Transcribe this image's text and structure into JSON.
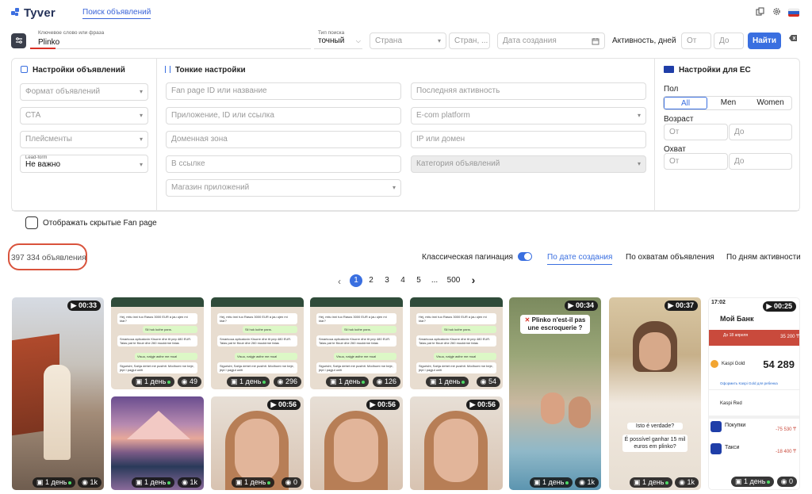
{
  "header": {
    "logo": "Tyver",
    "nav_link": "Поиск объявлений",
    "icons": [
      "copy-icon",
      "gear-icon",
      "flag-ru-icon"
    ]
  },
  "search": {
    "keyword_label": "Ключевое слово или фраза",
    "keyword_value": "Plinko",
    "search_type_label": "Тип поиска",
    "search_type_value": "точный",
    "country_placeholder": "Страна",
    "country2_placeholder": "Стран, ...",
    "created_placeholder": "Дата создания",
    "activity_label": "Активность, дней",
    "from_placeholder": "От",
    "to_placeholder": "До",
    "find_button": "Найти"
  },
  "ad_settings": {
    "title": "Настройки объявлений",
    "format_placeholder": "Формат объявлений",
    "cta_placeholder": "СТА",
    "placements_placeholder": "Плейсменты",
    "leadform_label": "Lead-form",
    "leadform_value": "Не важно"
  },
  "fine_settings": {
    "title": "Тонкие настройки",
    "fan_page": "Fan page ID или название",
    "app": "Приложение, ID или ссылка",
    "domain_zone": "Доменная зона",
    "in_link": "В ссылке",
    "app_store": "Магазин приложений",
    "last_activity": "Последняя активность",
    "ecom": "E-com platform",
    "ip_domain": "IP или домен",
    "category": "Категория объявлений"
  },
  "eu_settings": {
    "title": "Настройки для ЕС",
    "gender_label": "Пол",
    "gender_options": [
      "All",
      "Men",
      "Women"
    ],
    "gender_selected": "All",
    "age_label": "Возраст",
    "reach_label": "Охват",
    "from_placeholder": "От",
    "to_placeholder": "До"
  },
  "hidden_fanpage_label": "Отображать скрытые Fan page",
  "results": {
    "count": "397 334 объявления",
    "classic_pagination": "Классическая пагинация",
    "sort_options": [
      "По дате создания",
      "По охватам объявления",
      "По дням активности"
    ],
    "sort_active": "По дате создания"
  },
  "pagination": {
    "pages": [
      "1",
      "2",
      "3",
      "4",
      "5",
      "...",
      "500"
    ],
    "current": "1"
  },
  "cards": {
    "c1": {
      "duration": "00:33",
      "days": "1 день",
      "views": "1k"
    },
    "c2": {
      "days": "1 день",
      "views": "49"
    },
    "c3": {
      "days": "1 день",
      "views": "296"
    },
    "c4": {
      "days": "1 день",
      "views": "126"
    },
    "c5": {
      "days": "1 день",
      "views": "54"
    },
    "c6": {
      "duration": "00:34",
      "caption": "Plinko n'est-il pas une escroquerie ?",
      "days": "1 день",
      "views": "1k"
    },
    "c7": {
      "duration": "00:37",
      "caption1": "Isto é verdade?",
      "caption2": "É possível ganhar 15 mil euros em plinko?",
      "days": "1 день",
      "views": "1k"
    },
    "c8": {
      "duration": "00:25",
      "time": "17:02",
      "bank": "Мой Банк",
      "date": "До 18 апреля",
      "amount_small": "35 200 ₸",
      "gold": "Kaspi Gold",
      "balance": "54 289",
      "gold_link": "Оформить Kaspi Gold для ребенка",
      "red": "Kaspi Red",
      "buy": "Покупки",
      "buy_sum": "-75 530 ₸",
      "taxi": "Такси",
      "taxi_sum": "-18 400 ₸",
      "days": "1 день",
      "views": "0"
    },
    "c9": {
      "days": "1 день",
      "views": "1k"
    },
    "c10": {
      "days": "1 день",
      "views": "0"
    },
    "c11": {
      "duration": "00:56"
    },
    "c12": {
      "duration": "00:56"
    },
    "c13": {
      "duration": "00:56"
    }
  },
  "wa_chat": {
    "msg1": "Hej, mitu inni tuo Rasus 3000 EUR a jau ujen mi ktar?",
    "msg2": "Sil huk kuthe pans.",
    "msg3": "Smarkoua aplicatovin Kisurre dhe tit pep 480 EUR. Talas pat te flicuir dhe 260 muukirme fatas",
    "msg4": "Visuu, nalgje asthe me mua!",
    "msg5": "Sigurisht, Sahja dehet mè pusthit. Mòdhumi me beje, jèpt I pagjut uniti"
  },
  "colors": {
    "accent": "#3a6fe0",
    "highlight": "#d9533c"
  }
}
